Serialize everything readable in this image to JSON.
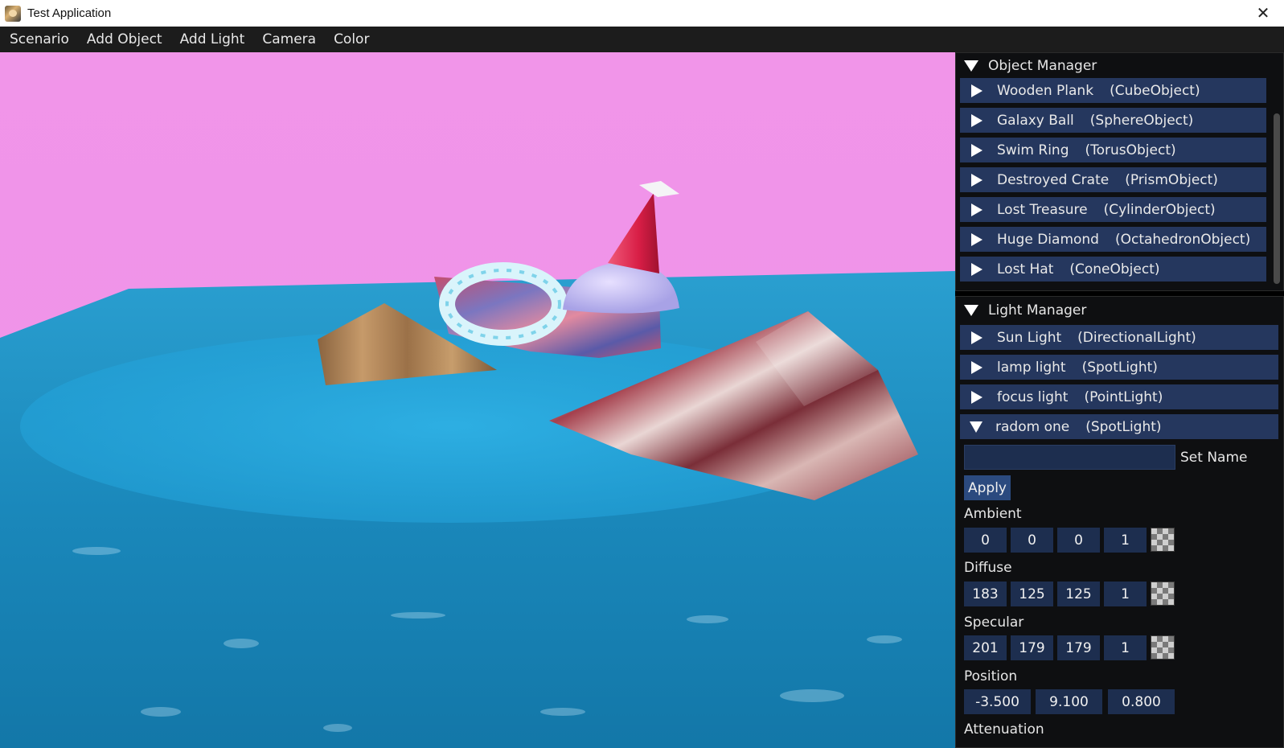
{
  "window": {
    "title": "Test Application",
    "close_symbol": "✕",
    "app_icon": "app-avatar-icon"
  },
  "menu": {
    "items": [
      "Scenario",
      "Add Object",
      "Add Light",
      "Camera",
      "Color"
    ]
  },
  "viewport": {
    "sky_color": "#f195e9",
    "water_color": "#1a8fc2"
  },
  "object_manager": {
    "title": "Object Manager",
    "items": [
      {
        "name": "Wooden Plank",
        "type": "(CubeObject)"
      },
      {
        "name": "Galaxy Ball",
        "type": "(SphereObject)"
      },
      {
        "name": "Swim Ring",
        "type": "(TorusObject)"
      },
      {
        "name": "Destroyed Crate",
        "type": "(PrismObject)"
      },
      {
        "name": "Lost Treasure",
        "type": "(CylinderObject)"
      },
      {
        "name": "Huge Diamond",
        "type": "(OctahedronObject)"
      },
      {
        "name": "Lost Hat",
        "type": "(ConeObject)"
      }
    ]
  },
  "light_manager": {
    "title": "Light Manager",
    "items": [
      {
        "name": "Sun Light",
        "type": "(DirectionalLight)"
      },
      {
        "name": "lamp light",
        "type": "(SpotLight)"
      },
      {
        "name": "focus light",
        "type": "(PointLight)"
      },
      {
        "name": "radom one",
        "type": "(SpotLight)",
        "expanded": true
      }
    ],
    "editor": {
      "name_value": "",
      "set_name_label": "Set Name",
      "apply_label": "Apply",
      "ambient": {
        "label": "Ambient",
        "values": [
          "0",
          "0",
          "0",
          "1"
        ]
      },
      "diffuse": {
        "label": "Diffuse",
        "values": [
          "183",
          "125",
          "125",
          "1"
        ]
      },
      "specular": {
        "label": "Specular",
        "values": [
          "201",
          "179",
          "179",
          "1"
        ]
      },
      "position": {
        "label": "Position",
        "values": [
          "-3.500",
          "9.100",
          "0.800"
        ]
      },
      "attenuation_label": "Attenuation"
    }
  },
  "colors": {
    "panel_bg": "#0e0f11",
    "row_bg": "#25375e",
    "button_bg": "#2b4a7f",
    "menubar_bg": "#1c1c1c"
  }
}
